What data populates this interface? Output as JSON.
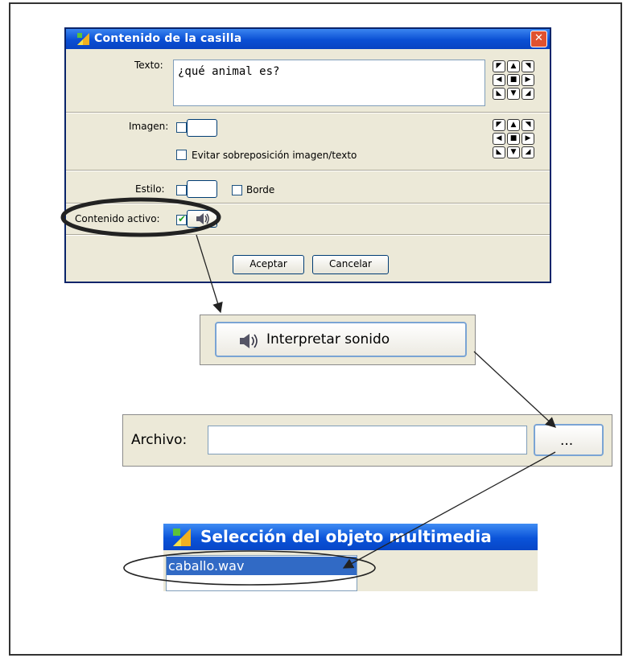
{
  "dialog": {
    "title": "Contenido de la casilla",
    "close_label": "✕",
    "texto": {
      "label": "Texto:",
      "value": "¿qué animal es?"
    },
    "imagen": {
      "label": "Imagen:",
      "overlap_checkbox_label": "Evitar sobreposición imagen/texto"
    },
    "estilo": {
      "label": "Estilo:",
      "border_checkbox_label": "Borde"
    },
    "contenido_activo": {
      "label": "Contenido activo:",
      "checked": true
    },
    "buttons": {
      "accept": "Aceptar",
      "cancel": "Cancelar"
    },
    "align_arrows": [
      "◤",
      "▲",
      "◥",
      "◀",
      "■",
      "▶",
      "◣",
      "▼",
      "◢"
    ]
  },
  "play_sound": {
    "button_label": "Interpretar sonido"
  },
  "archivo": {
    "label": "Archivo:",
    "value": "",
    "browse_label": "..."
  },
  "media_selection": {
    "title": "Selección del objeto multimedia",
    "items": [
      "caballo.wav"
    ]
  },
  "colors": {
    "titlebar": "#0a4fd4",
    "dialog_bg": "#ece9d8",
    "selection": "#316ac5",
    "close_button": "#e0522f"
  }
}
